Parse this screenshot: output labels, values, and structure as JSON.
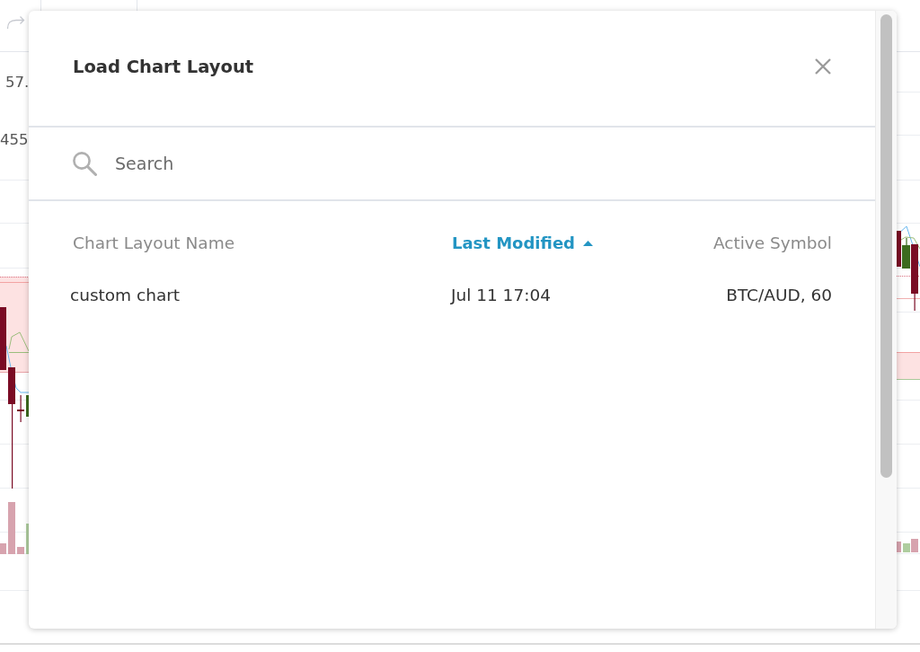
{
  "background_chart": {
    "price_labels": [
      "57.",
      "455"
    ]
  },
  "dialog": {
    "title": "Load Chart Layout",
    "search": {
      "placeholder": "Search"
    },
    "table": {
      "sort_ascending": true,
      "columns": [
        {
          "label": "Chart Layout Name",
          "sorted": false
        },
        {
          "label": "Last Modified",
          "sorted": true
        },
        {
          "label": "Active Symbol",
          "sorted": false
        }
      ],
      "rows": [
        {
          "cells": [
            "custom chart",
            "Jul 11 17:04",
            "BTC/AUD, 60"
          ]
        }
      ]
    }
  }
}
